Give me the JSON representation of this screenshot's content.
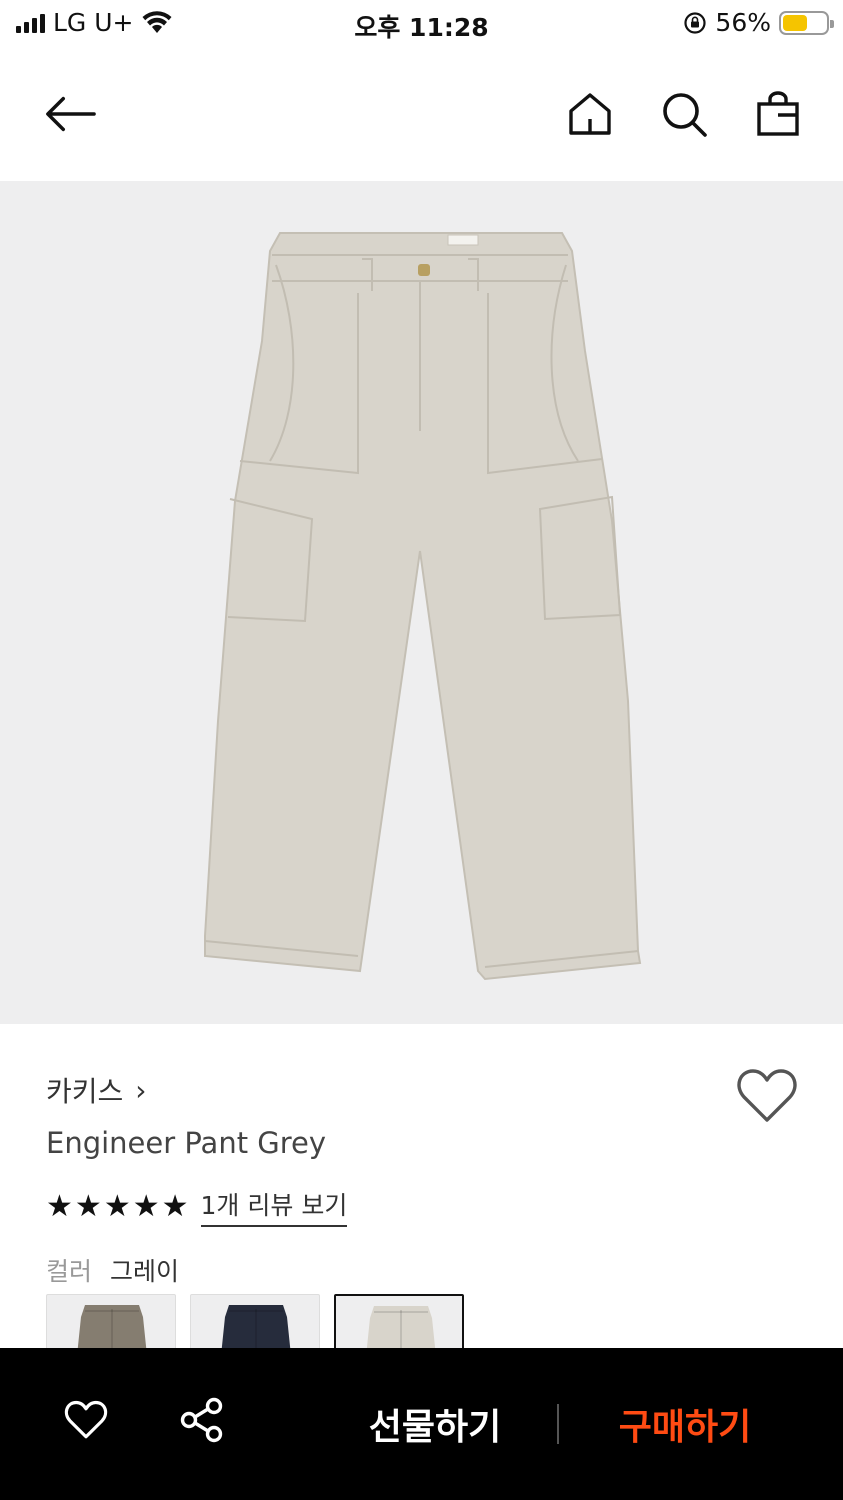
{
  "status_bar": {
    "carrier": "LG U+",
    "time": "오후 11:28",
    "battery_percent": "56%",
    "battery_level": 0.56
  },
  "nav": {
    "icons": [
      "back-arrow-icon",
      "home-icon",
      "search-icon",
      "shopping-bag-icon"
    ]
  },
  "product": {
    "brand": "카키스",
    "brand_chevron": "›",
    "name": "Engineer Pant Grey",
    "rating_stars": 5,
    "review_link": "1개 리뷰 보기",
    "color_label": "컬러",
    "color_value": "그레이",
    "swatches": [
      {
        "color": "#857d70",
        "selected": false
      },
      {
        "color": "#262c3c",
        "selected": false
      },
      {
        "color": "#d8d4cb",
        "selected": true
      }
    ],
    "pant_color": "#d8d4cb"
  },
  "bottom_bar": {
    "gift_label": "선물하기",
    "buy_label": "구매하기",
    "buy_color": "#ff4b13"
  }
}
